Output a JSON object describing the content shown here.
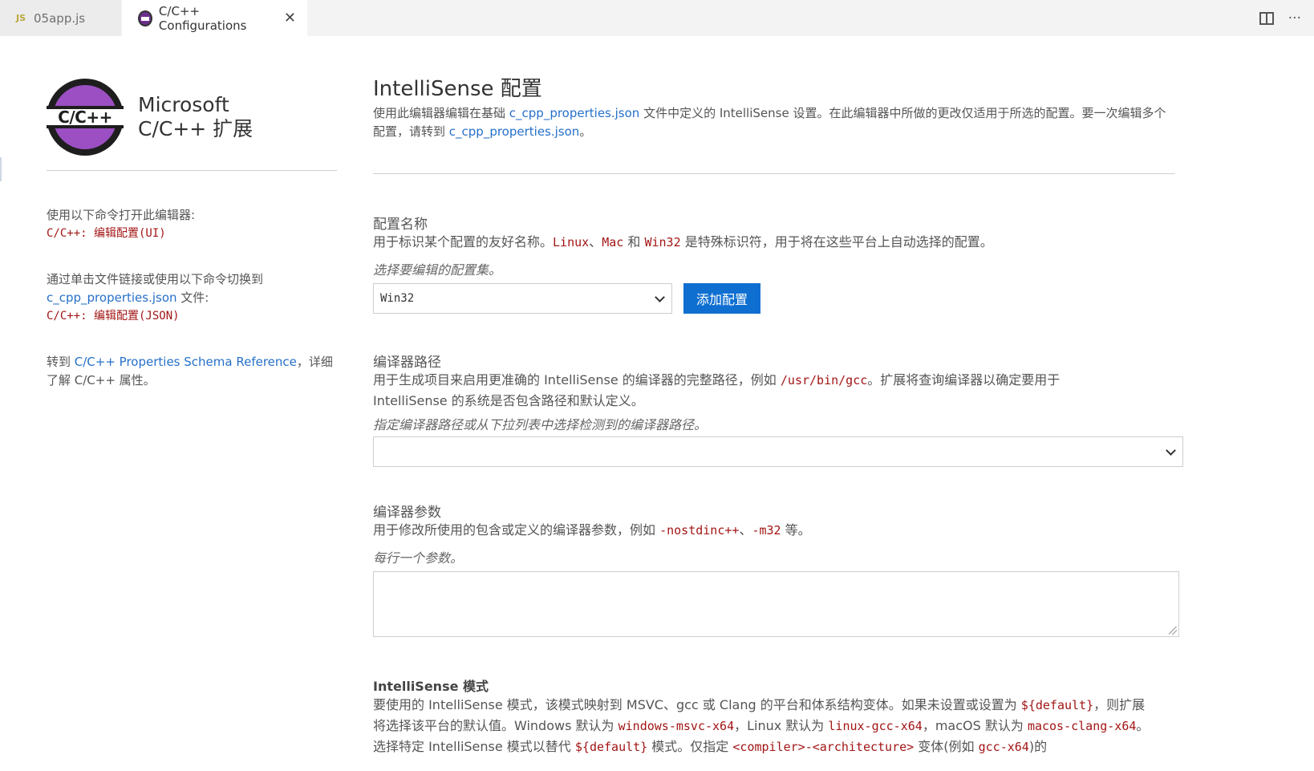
{
  "tabs": [
    {
      "badge": "JS",
      "label": "05app.js"
    },
    {
      "label": "C/C++ Configurations",
      "close": "✕"
    }
  ],
  "tab_actions": {
    "more": "···"
  },
  "brand": {
    "logo_text": "C/C++",
    "line1": "Microsoft",
    "line2": "C/C++ 扩展"
  },
  "left": {
    "block1_text": "使用以下命令打开此编辑器:",
    "block1_cmd": "C/C++: 编辑配置(UI)",
    "block2_text": "通过单击文件链接或使用以下命令切换到",
    "block2_link": "c_cpp_properties.json",
    "block2_suffix": " 文件:",
    "block2_cmd": "C/C++: 编辑配置(JSON)",
    "block3_prefix": "转到 ",
    "block3_link": "C/C++ Properties Schema Reference",
    "block3_suffix": "，详细了解 C/C++ 属性。"
  },
  "main": {
    "title": "IntelliSense 配置",
    "desc_prefix": "使用此编辑器编辑在基础 ",
    "desc_link1": "c_cpp_properties.json",
    "desc_mid": " 文件中定义的 IntelliSense 设置。在此编辑器中所做的更改仅适用于所选的配置。要一次编辑多个配置，请转到 ",
    "desc_link2": "c_cpp_properties.json",
    "desc_end": "。"
  },
  "config_name": {
    "title": "配置名称",
    "desc_a": "用于标识某个配置的友好名称。",
    "code1": "Linux",
    "sep1": "、",
    "code2": "Mac",
    "and": " 和 ",
    "code3": "Win32",
    "desc_b": " 是特殊标识符，用于将在这些平台上自动选择的配置。",
    "hint": "选择要编辑的配置集。",
    "selected": "Win32",
    "add_button": "添加配置"
  },
  "compiler_path": {
    "title": "编译器路径",
    "desc_a": "用于生成项目来启用更准确的 IntelliSense 的编译器的完整路径，例如 ",
    "code": "/usr/bin/gcc",
    "desc_b": "。扩展将查询编译器以确定要用于 IntelliSense 的系统是否包含路径和默认定义。",
    "hint": "指定编译器路径或从下拉列表中选择检测到的编译器路径。",
    "value": ""
  },
  "compiler_args": {
    "title": "编译器参数",
    "desc_a": "用于修改所使用的包含或定义的编译器参数，例如 ",
    "code1": "-nostdinc++",
    "sep": "、",
    "code2": "-m32",
    "desc_b": " 等。",
    "hint": "每行一个参数。",
    "value": ""
  },
  "intellisense_mode": {
    "title": "IntelliSense 模式",
    "desc_a": "要使用的 IntelliSense 模式，该模式映射到 MSVC、gcc 或 Clang 的平台和体系结构变体。如果未设置或设置为 ",
    "code1": "${default}",
    "desc_b": "，则扩展将选择该平台的默认值。Windows 默认为 ",
    "code2": "windows-msvc-x64",
    "desc_c": "，Linux 默认为 ",
    "code3": "linux-gcc-x64",
    "desc_d": "，macOS 默认为 ",
    "code4": "macos-clang-x64",
    "desc_e": "。选择特定 IntelliSense 模式以替代 ",
    "code5": "${default}",
    "desc_f": " 模式。仅指定 ",
    "code6": "<compiler>-<architecture>",
    "desc_g": " 变体(例如 ",
    "code7": "gcc-x64",
    "desc_h": ")的"
  }
}
